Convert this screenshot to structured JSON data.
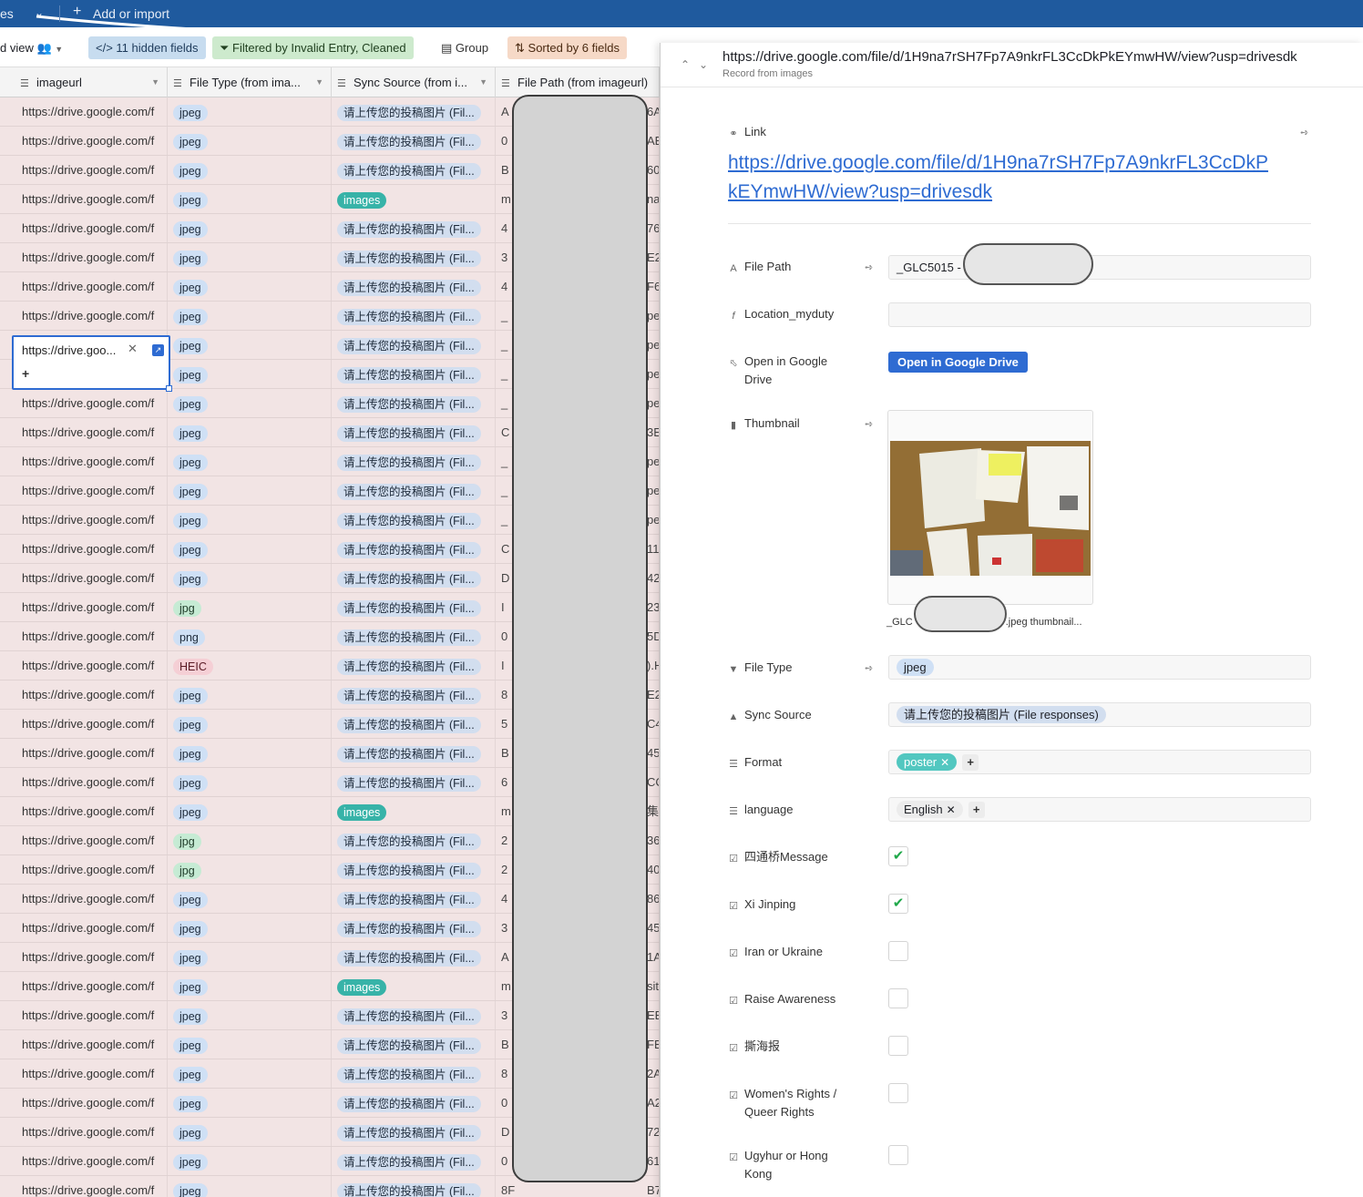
{
  "topbar": {
    "left_text": "es",
    "add_label": "Add or import"
  },
  "viewbar": {
    "view_label": "d view",
    "hidden_fields": "11 hidden fields",
    "filtered": "Filtered by Invalid Entry, Cleaned",
    "group": "Group",
    "sorted": "Sorted by 6 fields"
  },
  "grid": {
    "columns": [
      "imageurl",
      "File Type (from ima...",
      "Sync Source (from i...",
      "File Path (from imageurl)"
    ],
    "rows": [
      {
        "url": "https://drive.google.com/f",
        "type": "jpeg",
        "src": "请上传您的投稿图片 (Fil...",
        "path": "A",
        "tail": "6A"
      },
      {
        "url": "https://drive.google.com/f",
        "type": "jpeg",
        "src": "请上传您的投稿图片 (Fil...",
        "path": "0",
        "tail": "AE"
      },
      {
        "url": "https://drive.google.com/f",
        "type": "jpeg",
        "src": "请上传您的投稿图片 (Fil...",
        "path": "B",
        "tail": "60"
      },
      {
        "url": "https://drive.google.com/f",
        "type": "jpeg",
        "src": "images",
        "path": "m",
        "tail": "na"
      },
      {
        "url": "https://drive.google.com/f",
        "type": "jpeg",
        "src": "请上传您的投稿图片 (Fil...",
        "path": "4",
        "tail": "76"
      },
      {
        "url": "https://drive.google.com/f",
        "type": "jpeg",
        "src": "请上传您的投稿图片 (Fil...",
        "path": "3",
        "tail": "E2"
      },
      {
        "url": "https://drive.google.com/f",
        "type": "jpeg",
        "src": "请上传您的投稿图片 (Fil...",
        "path": "4",
        "tail": "F6"
      },
      {
        "url": "https://drive.google.com/f",
        "type": "jpeg",
        "src": "请上传您的投稿图片 (Fil...",
        "path": "_",
        "tail": "pe"
      },
      {
        "url": "https://drive.google.com/f",
        "type": "jpeg",
        "src": "请上传您的投稿图片 (Fil...",
        "path": "_",
        "tail": "pe"
      },
      {
        "url": "https://drive.goo...",
        "type": "jpeg",
        "src": "请上传您的投稿图片 (Fil...",
        "path": "_",
        "tail": "pe"
      },
      {
        "url": "https://drive.google.com/f",
        "type": "jpeg",
        "src": "请上传您的投稿图片 (Fil...",
        "path": "_",
        "tail": "pe"
      },
      {
        "url": "https://drive.google.com/f",
        "type": "jpeg",
        "src": "请上传您的投稿图片 (Fil...",
        "path": "C",
        "tail": "3E"
      },
      {
        "url": "https://drive.google.com/f",
        "type": "jpeg",
        "src": "请上传您的投稿图片 (Fil...",
        "path": "_",
        "tail": "pe"
      },
      {
        "url": "https://drive.google.com/f",
        "type": "jpeg",
        "src": "请上传您的投稿图片 (Fil...",
        "path": "_",
        "tail": "pe"
      },
      {
        "url": "https://drive.google.com/f",
        "type": "jpeg",
        "src": "请上传您的投稿图片 (Fil...",
        "path": "_",
        "tail": "pe"
      },
      {
        "url": "https://drive.google.com/f",
        "type": "jpeg",
        "src": "请上传您的投稿图片 (Fil...",
        "path": "C",
        "tail": "11"
      },
      {
        "url": "https://drive.google.com/f",
        "type": "jpeg",
        "src": "请上传您的投稿图片 (Fil...",
        "path": "D",
        "tail": "42"
      },
      {
        "url": "https://drive.google.com/f",
        "type": "jpg",
        "src": "请上传您的投稿图片 (Fil...",
        "path": "I",
        "tail": "23"
      },
      {
        "url": "https://drive.google.com/f",
        "type": "png",
        "src": "请上传您的投稿图片 (Fil...",
        "path": "0",
        "tail": "5D"
      },
      {
        "url": "https://drive.google.com/f",
        "type": "HEIC",
        "src": "请上传您的投稿图片 (Fil...",
        "path": "I",
        "tail": ").H"
      },
      {
        "url": "https://drive.google.com/f",
        "type": "jpeg",
        "src": "请上传您的投稿图片 (Fil...",
        "path": "8",
        "tail": "E2"
      },
      {
        "url": "https://drive.google.com/f",
        "type": "jpeg",
        "src": "请上传您的投稿图片 (Fil...",
        "path": "5",
        "tail": "C4"
      },
      {
        "url": "https://drive.google.com/f",
        "type": "jpeg",
        "src": "请上传您的投稿图片 (Fil...",
        "path": "B",
        "tail": "45"
      },
      {
        "url": "https://drive.google.com/f",
        "type": "jpeg",
        "src": "请上传您的投稿图片 (Fil...",
        "path": "6",
        "tail": "CC"
      },
      {
        "url": "https://drive.google.com/f",
        "type": "jpeg",
        "src": "images",
        "path": "m",
        "tail": "集"
      },
      {
        "url": "https://drive.google.com/f",
        "type": "jpg",
        "src": "请上传您的投稿图片 (Fil...",
        "path": "2",
        "tail": "36"
      },
      {
        "url": "https://drive.google.com/f",
        "type": "jpg",
        "src": "请上传您的投稿图片 (Fil...",
        "path": "2",
        "tail": "40"
      },
      {
        "url": "https://drive.google.com/f",
        "type": "jpeg",
        "src": "请上传您的投稿图片 (Fil...",
        "path": "4",
        "tail": "86"
      },
      {
        "url": "https://drive.google.com/f",
        "type": "jpeg",
        "src": "请上传您的投稿图片 (Fil...",
        "path": "3",
        "tail": "45"
      },
      {
        "url": "https://drive.google.com/f",
        "type": "jpeg",
        "src": "请上传您的投稿图片 (Fil...",
        "path": "A",
        "tail": "1A"
      },
      {
        "url": "https://drive.google.com/f",
        "type": "jpeg",
        "src": "images",
        "path": "m",
        "tail": "sit"
      },
      {
        "url": "https://drive.google.com/f",
        "type": "jpeg",
        "src": "请上传您的投稿图片 (Fil...",
        "path": "3",
        "tail": "EB"
      },
      {
        "url": "https://drive.google.com/f",
        "type": "jpeg",
        "src": "请上传您的投稿图片 (Fil...",
        "path": "B",
        "tail": "FB"
      },
      {
        "url": "https://drive.google.com/f",
        "type": "jpeg",
        "src": "请上传您的投稿图片 (Fil...",
        "path": "8",
        "tail": "2A"
      },
      {
        "url": "https://drive.google.com/f",
        "type": "jpeg",
        "src": "请上传您的投稿图片 (Fil...",
        "path": "0",
        "tail": "A2"
      },
      {
        "url": "https://drive.google.com/f",
        "type": "jpeg",
        "src": "请上传您的投稿图片 (Fil...",
        "path": "D",
        "tail": "72"
      },
      {
        "url": "https://drive.google.com/f",
        "type": "jpeg",
        "src": "请上传您的投稿图片 (Fil...",
        "path": "0",
        "tail": "61"
      },
      {
        "url": "https://drive.google.com/f",
        "type": "jpeg",
        "src": "请上传您的投稿图片 (Fil...",
        "path": "8F",
        "tail": "B7"
      }
    ],
    "selected_cell": "https://drive.goo..."
  },
  "panel": {
    "title": "https://drive.google.com/file/d/1H9na7rSH7Fp7A9nkrFL3CcDkPkEYmwHW/view?usp=drivesdk",
    "subtitle": "Record from images",
    "link_label": "Link",
    "link_line1": "https://drive.google.com/file/d/1H9na7rSH7Fp7A9nkrFL3CcDkP",
    "link_line2": "kEYmwHW/view?usp=drivesdk",
    "fields": {
      "file_path": {
        "label": "File Path",
        "value": "_GLC5015 -"
      },
      "location": {
        "label": "Location_myduty",
        "value": ""
      },
      "open_drive": {
        "label_1": "Open in Google",
        "label_2": "Drive",
        "button": "Open in Google Drive"
      },
      "thumbnail": {
        "label": "Thumbnail",
        "caption_left": "_GLC",
        "caption_right": ".jpeg thumbnail..."
      },
      "file_type": {
        "label": "File Type",
        "value": "jpeg"
      },
      "sync_source": {
        "label": "Sync Source",
        "value": "请上传您的投稿图片 (File responses)"
      },
      "format": {
        "label": "Format",
        "value": "poster"
      },
      "language": {
        "label": "language",
        "value": "English"
      },
      "cb1": {
        "label": "四通桥Message",
        "checked": true
      },
      "cb2": {
        "label": "Xi Jinping",
        "checked": true
      },
      "cb3": {
        "label": "Iran or Ukraine",
        "checked": false
      },
      "cb4": {
        "label": "Raise Awareness",
        "checked": false
      },
      "cb5": {
        "label": "撕海报",
        "checked": false
      },
      "cb6": {
        "label_1": "Women's Rights /",
        "label_2": "Queer Rights",
        "checked": false
      },
      "cb7": {
        "label_1": "Ugyhur or Hong",
        "label_2": "Kong",
        "checked": false
      }
    }
  },
  "colors": {
    "topbar": "#1f5a9e",
    "accent": "#2e6bd2",
    "row_bg": "#f2e4e4",
    "check": "#20a84a"
  }
}
